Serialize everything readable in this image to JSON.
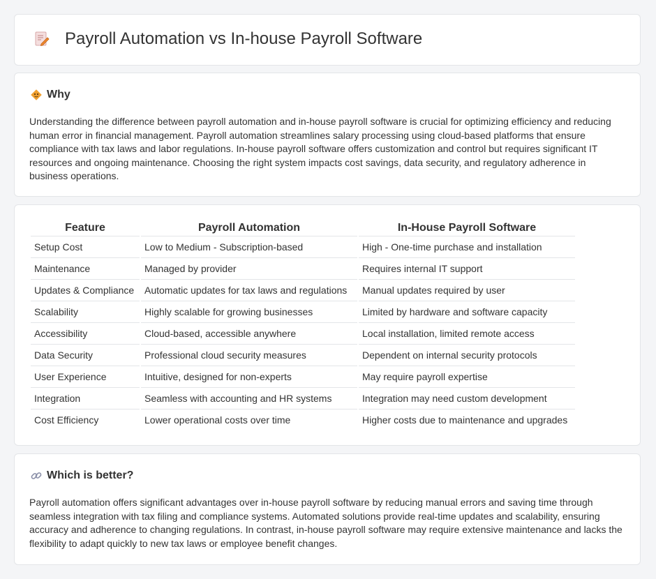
{
  "header": {
    "title": "Payroll Automation vs In-house Payroll Software",
    "icon": "document-pencil-icon"
  },
  "why": {
    "heading": "Why",
    "icon": "diamond-warning-icon",
    "text": "Understanding the difference between payroll automation and in-house payroll software is crucial for optimizing efficiency and reducing human error in financial management. Payroll automation streamlines salary processing using cloud-based platforms that ensure compliance with tax laws and labor regulations. In-house payroll software offers customization and control but requires significant IT resources and ongoing maintenance. Choosing the right system impacts cost savings, data security, and regulatory adherence in business operations."
  },
  "comparison": {
    "headers": [
      "Feature",
      "Payroll Automation",
      "In-House Payroll Software"
    ],
    "rows": [
      [
        "Setup Cost",
        "Low to Medium - Subscription-based",
        "High - One-time purchase and installation"
      ],
      [
        "Maintenance",
        "Managed by provider",
        "Requires internal IT support"
      ],
      [
        "Updates & Compliance",
        "Automatic updates for tax laws and regulations",
        "Manual updates required by user"
      ],
      [
        "Scalability",
        "Highly scalable for growing businesses",
        "Limited by hardware and software capacity"
      ],
      [
        "Accessibility",
        "Cloud-based, accessible anywhere",
        "Local installation, limited remote access"
      ],
      [
        "Data Security",
        "Professional cloud security measures",
        "Dependent on internal security protocols"
      ],
      [
        "User Experience",
        "Intuitive, designed for non-experts",
        "May require payroll expertise"
      ],
      [
        "Integration",
        "Seamless with accounting and HR systems",
        "Integration may need custom development"
      ],
      [
        "Cost Efficiency",
        "Lower operational costs over time",
        "Higher costs due to maintenance and upgrades"
      ]
    ]
  },
  "better": {
    "heading": "Which is better?",
    "icon": "link-icon",
    "text": "Payroll automation offers significant advantages over in-house payroll software by reducing manual errors and saving time through seamless integration with tax filing and compliance systems. Automated solutions provide real-time updates and scalability, ensuring accuracy and adherence to changing regulations. In contrast, in-house payroll software may require extensive maintenance and lacks the flexibility to adapt quickly to new tax laws or employee benefit changes."
  },
  "colors": {
    "background": "#f4f5f7",
    "card": "#ffffff",
    "border": "#e3e5e8",
    "text": "#333333",
    "accent_orange": "#f0a030"
  }
}
